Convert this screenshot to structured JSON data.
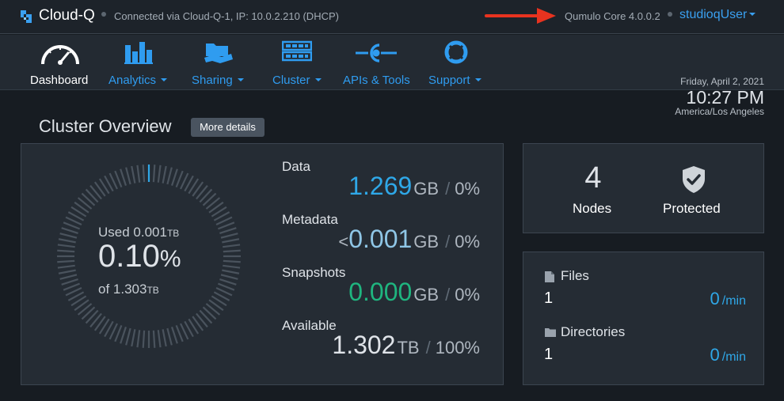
{
  "topbar": {
    "app_name": "Cloud-Q",
    "connection": "Connected via Cloud-Q-1, IP: 10.0.2.210 (DHCP)",
    "version": "Qumulo Core 4.0.0.2",
    "user": "studioqUser"
  },
  "nav": {
    "items": [
      {
        "label": "Dashboard",
        "icon": "speedometer-icon"
      },
      {
        "label": "Analytics",
        "icon": "bar-chart-icon"
      },
      {
        "label": "Sharing",
        "icon": "folder-share-icon"
      },
      {
        "label": "Cluster",
        "icon": "server-icon"
      },
      {
        "label": "APIs & Tools",
        "icon": "api-plug-icon"
      },
      {
        "label": "Support",
        "icon": "lifebuoy-icon"
      }
    ]
  },
  "datetime": {
    "date": "Friday, April 2, 2021",
    "time": "10:27 PM",
    "timezone": "America/Los Angeles"
  },
  "overview": {
    "title": "Cluster Overview",
    "more_details": "More details",
    "gauge": {
      "used_label": "Used",
      "used_value": "0.001",
      "used_unit": "TB",
      "percent_value": "0.10",
      "percent_sign": "%",
      "of_label": "of",
      "total_value": "1.303",
      "total_unit": "TB",
      "used_fraction": 0.001
    },
    "stats": [
      {
        "label": "Data",
        "prefix": "",
        "value": "1.269",
        "unit": "GB",
        "pct": "0%",
        "color": "#2fa8e8"
      },
      {
        "label": "Metadata",
        "prefix": "<",
        "value": "0.001",
        "unit": "GB",
        "pct": "0%",
        "color": "#8fc6e6"
      },
      {
        "label": "Snapshots",
        "prefix": "",
        "value": "0.000",
        "unit": "GB",
        "pct": "0%",
        "color": "#1fb57f"
      },
      {
        "label": "Available",
        "prefix": "",
        "value": "1.302",
        "unit": "TB",
        "pct": "100%",
        "color": "#dfe3e8"
      }
    ]
  },
  "nodes": {
    "count": "4",
    "label": "Nodes",
    "protected_label": "Protected"
  },
  "activity": {
    "files_label": "Files",
    "files_count": "1",
    "files_rate": "0",
    "directories_label": "Directories",
    "directories_count": "1",
    "directories_rate": "0",
    "rate_unit": "/min"
  },
  "colors": {
    "accent": "#2f9cf0",
    "arrow": "#e8331f",
    "background": "#171c22"
  }
}
